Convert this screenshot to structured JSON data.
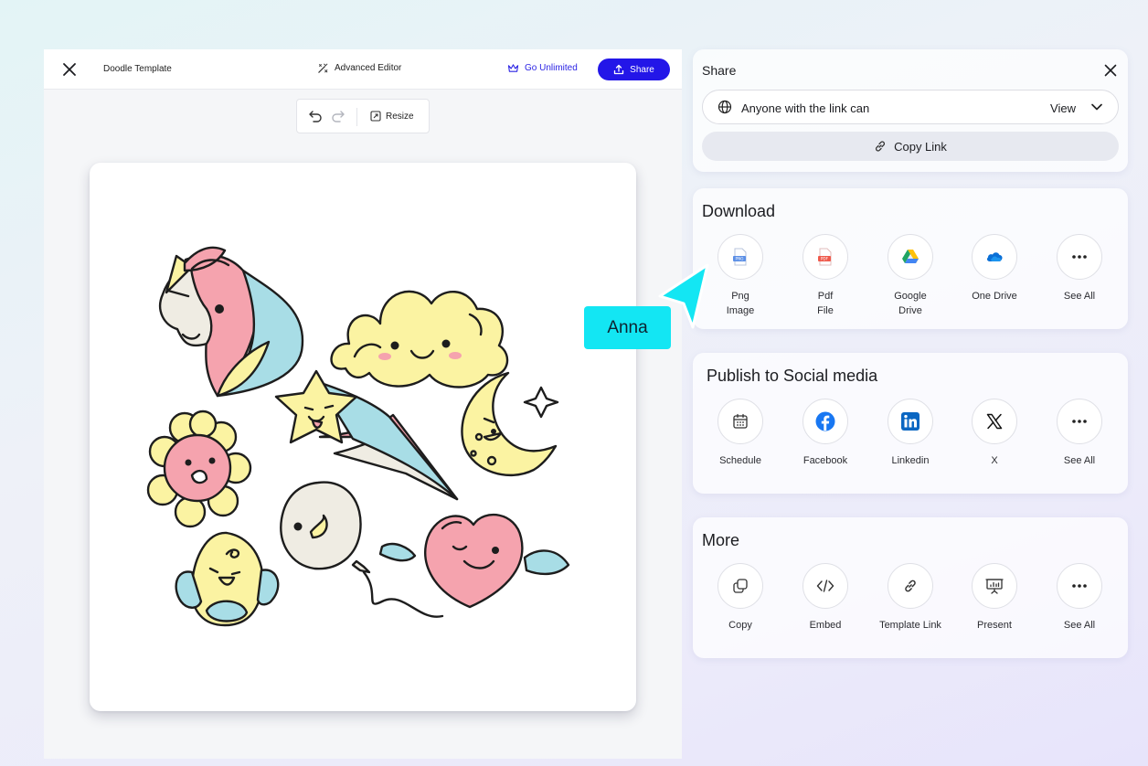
{
  "editor": {
    "title": "Doodle Template",
    "advanced_editor_label": "Advanced Editor",
    "go_unlimited_label": "Go Unlimited",
    "share_button_label": "Share",
    "toolbar": {
      "resize_label": "Resize"
    }
  },
  "share_panel": {
    "title": "Share",
    "access_text": "Anyone with the link can",
    "access_value": "View",
    "copy_link_label": "Copy Link"
  },
  "download": {
    "title": "Download",
    "options": [
      {
        "label": "Png\nImage",
        "icon": "png-file-icon"
      },
      {
        "label": "Pdf\nFile",
        "icon": "pdf-file-icon"
      },
      {
        "label": "Google\nDrive",
        "icon": "google-drive-icon"
      },
      {
        "label": "One Drive",
        "icon": "onedrive-icon"
      },
      {
        "label": "See All",
        "icon": "more-dots-icon"
      }
    ]
  },
  "social": {
    "title": "Publish to Social media",
    "options": [
      {
        "label": "Schedule",
        "icon": "calendar-icon"
      },
      {
        "label": "Facebook",
        "icon": "facebook-icon"
      },
      {
        "label": "Linkedin",
        "icon": "linkedin-icon"
      },
      {
        "label": "X",
        "icon": "x-logo-icon"
      },
      {
        "label": "See All",
        "icon": "more-dots-icon"
      }
    ]
  },
  "more": {
    "title": "More",
    "options": [
      {
        "label": "Copy",
        "icon": "copy-icon"
      },
      {
        "label": "Embed",
        "icon": "code-icon"
      },
      {
        "label": "Template Link",
        "icon": "link-icon"
      },
      {
        "label": "Present",
        "icon": "presentation-icon"
      },
      {
        "label": "See All",
        "icon": "more-dots-icon"
      }
    ]
  },
  "collaborator": {
    "name": "Anna",
    "color": "#13e6f3"
  },
  "colors": {
    "brand_blue": "#2316e8",
    "doodle_yellow": "#fbf3a2",
    "doodle_pink": "#f5a3ae",
    "doodle_blue": "#a8dde6",
    "doodle_cream": "#efece3"
  }
}
